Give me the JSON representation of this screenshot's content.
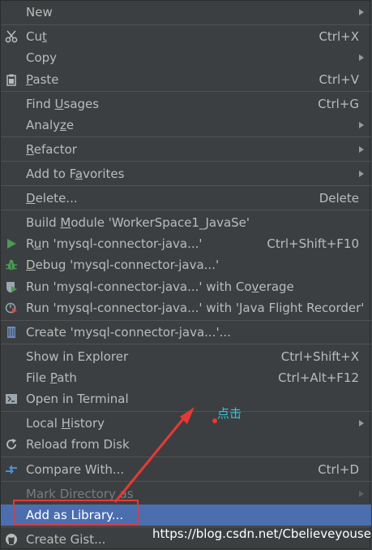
{
  "menu": {
    "new": {
      "label": "New"
    },
    "cut": {
      "pre": "Cu",
      "u": "t",
      "post": "",
      "shortcut": "Ctrl+X"
    },
    "copy": {
      "label": "Copy"
    },
    "paste": {
      "pre": "",
      "u": "P",
      "post": "aste",
      "shortcut": "Ctrl+V"
    },
    "find_usages": {
      "pre": "Find ",
      "u": "U",
      "post": "sages",
      "shortcut": "Ctrl+G"
    },
    "analyze": {
      "pre": "Analy",
      "u": "z",
      "post": "e"
    },
    "refactor": {
      "pre": "",
      "u": "R",
      "post": "efactor"
    },
    "add_favorites": {
      "pre": "Add to F",
      "u": "a",
      "post": "vorites"
    },
    "delete": {
      "pre": "",
      "u": "D",
      "post": "elete...",
      "shortcut": "Delete"
    },
    "build_module": {
      "pre": "Build ",
      "u": "M",
      "post": "odule 'WorkerSpace1_JavaSe'"
    },
    "run": {
      "pre": "R",
      "u": "u",
      "post": "n 'mysql-connector-java...'",
      "shortcut": "Ctrl+Shift+F10"
    },
    "debug": {
      "pre": "",
      "u": "D",
      "post": "ebug 'mysql-connector-java...'"
    },
    "run_coverage": {
      "pre": "Run 'mysql-connector-java...' with Co",
      "u": "v",
      "post": "erage"
    },
    "run_jfr": {
      "label": "Run 'mysql-connector-java...' with 'Java Flight Recorder'"
    },
    "create": {
      "label": "Create 'mysql-connector-java...'..."
    },
    "show_explorer": {
      "label": "Show in Explorer",
      "shortcut": "Ctrl+Shift+X"
    },
    "file_path": {
      "pre": "File ",
      "u": "P",
      "post": "ath",
      "shortcut": "Ctrl+Alt+F12"
    },
    "open_terminal": {
      "label": "Open in Terminal"
    },
    "local_history": {
      "pre": "Local ",
      "u": "H",
      "post": "istory"
    },
    "reload": {
      "label": "Reload from Disk"
    },
    "compare": {
      "label": "Compare With...",
      "shortcut": "Ctrl+D"
    },
    "mark_directory": {
      "label": "Mark Directory as"
    },
    "add_library": {
      "label": "Add as Library..."
    },
    "create_gist": {
      "label": "Create Gist..."
    }
  },
  "annotation": {
    "text": "点击",
    "color": "#e53935"
  },
  "watermark": "https://blog.csdn.net/Cbelieveyouself",
  "colors": {
    "menu_bg": "#3c3f41",
    "selected_bg": "#4b6eaf",
    "text": "#bbbbbb"
  }
}
